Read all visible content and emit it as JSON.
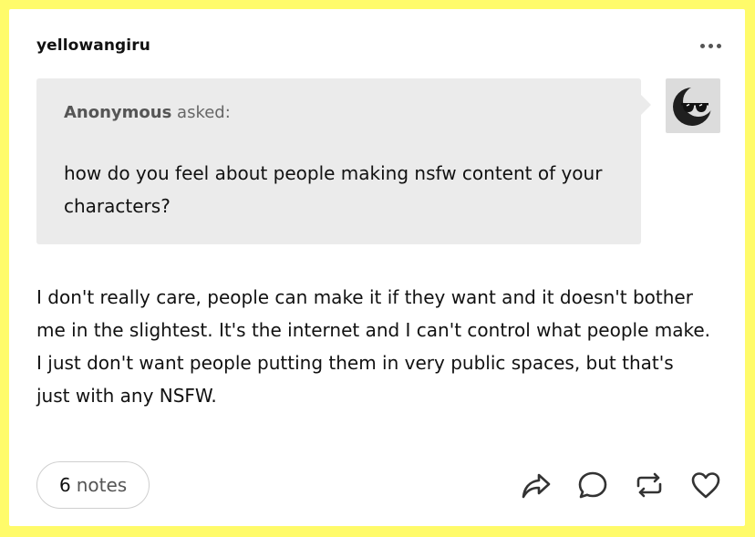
{
  "post": {
    "username": "yellowangiru",
    "more_icon": "more-horizontal-icon",
    "ask": {
      "asker_name": "Anonymous",
      "asked_label": "asked:",
      "question": "how do you feel about people making nsfw content of your characters?"
    },
    "answer": "I don't really care, people can make it if they want and it doesn't bother me in the slightest. It's the internet and I can't control what people make. I just don't want people putting them in very public spaces, but that's just with any NSFW.",
    "notes": {
      "count": "6",
      "label": "notes"
    },
    "actions": [
      "share-icon",
      "reply-icon",
      "reblog-icon",
      "like-icon"
    ]
  },
  "colors": {
    "frame": "#fffb6a",
    "card": "#ffffff",
    "ask_bg": "#ebebeb",
    "text": "#111111",
    "muted": "#555555"
  }
}
